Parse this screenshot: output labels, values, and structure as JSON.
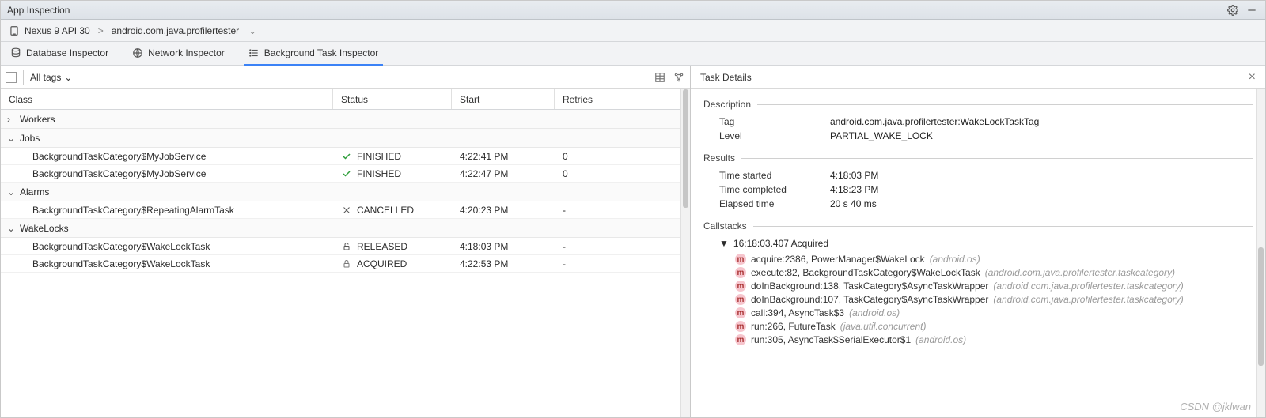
{
  "window": {
    "title": "App Inspection"
  },
  "device": {
    "name": "Nexus 9 API 30",
    "process": "android.com.java.profilertester"
  },
  "tabs": [
    {
      "label": "Database Inspector"
    },
    {
      "label": "Network Inspector"
    },
    {
      "label": "Background Task Inspector"
    }
  ],
  "filter": {
    "tags_label": "All tags"
  },
  "columns": {
    "class": "Class",
    "status": "Status",
    "start": "Start",
    "retries": "Retries"
  },
  "groups": [
    {
      "name": "Workers",
      "expanded": false,
      "rows": []
    },
    {
      "name": "Jobs",
      "expanded": true,
      "rows": [
        {
          "class": "BackgroundTaskCategory$MyJobService",
          "status": "FINISHED",
          "status_kind": "finished",
          "start": "4:22:41 PM",
          "retries": "0"
        },
        {
          "class": "BackgroundTaskCategory$MyJobService",
          "status": "FINISHED",
          "status_kind": "finished",
          "start": "4:22:47 PM",
          "retries": "0"
        }
      ]
    },
    {
      "name": "Alarms",
      "expanded": true,
      "rows": [
        {
          "class": "BackgroundTaskCategory$RepeatingAlarmTask",
          "status": "CANCELLED",
          "status_kind": "cancelled",
          "start": "4:20:23 PM",
          "retries": "-"
        }
      ]
    },
    {
      "name": "WakeLocks",
      "expanded": true,
      "rows": [
        {
          "class": "BackgroundTaskCategory$WakeLockTask",
          "status": "RELEASED",
          "status_kind": "released",
          "start": "4:18:03 PM",
          "retries": "-"
        },
        {
          "class": "BackgroundTaskCategory$WakeLockTask",
          "status": "ACQUIRED",
          "status_kind": "acquired",
          "start": "4:22:53 PM",
          "retries": "-"
        }
      ]
    }
  ],
  "details": {
    "title": "Task Details",
    "description_label": "Description",
    "tag_label": "Tag",
    "tag_value": "android.com.java.profilertester:WakeLockTaskTag",
    "level_label": "Level",
    "level_value": "PARTIAL_WAKE_LOCK",
    "results_label": "Results",
    "time_started_label": "Time started",
    "time_started_value": "4:18:03 PM",
    "time_completed_label": "Time completed",
    "time_completed_value": "4:18:23 PM",
    "elapsed_label": "Elapsed time",
    "elapsed_value": "20 s 40 ms",
    "callstacks_label": "Callstacks",
    "callstack_header": "16:18:03.407 Acquired",
    "stack": [
      {
        "sig": "acquire:2386, PowerManager$WakeLock",
        "pkg": "(android.os)"
      },
      {
        "sig": "execute:82, BackgroundTaskCategory$WakeLockTask",
        "pkg": "(android.com.java.profilertester.taskcategory)"
      },
      {
        "sig": "doInBackground:138, TaskCategory$AsyncTaskWrapper",
        "pkg": "(android.com.java.profilertester.taskcategory)"
      },
      {
        "sig": "doInBackground:107, TaskCategory$AsyncTaskWrapper",
        "pkg": "(android.com.java.profilertester.taskcategory)"
      },
      {
        "sig": "call:394, AsyncTask$3",
        "pkg": "(android.os)"
      },
      {
        "sig": "run:266, FutureTask",
        "pkg": "(java.util.concurrent)"
      },
      {
        "sig": "run:305, AsyncTask$SerialExecutor$1",
        "pkg": "(android.os)"
      }
    ]
  },
  "watermark": "CSDN @jklwan"
}
